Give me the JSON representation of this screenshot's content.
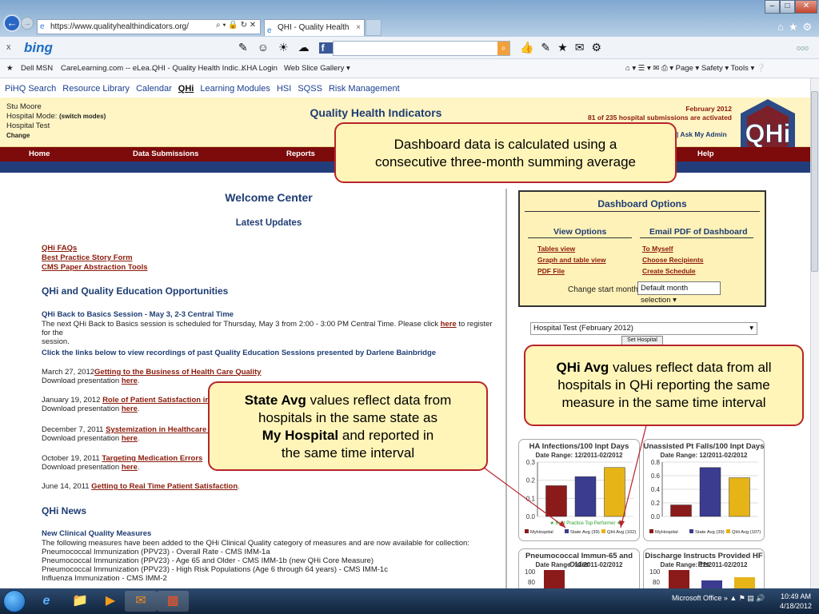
{
  "browser": {
    "address": "https://www.qualityhealthindicators.org/",
    "tab_title": "QHI - Quality Health Indica...",
    "tab_close": "×"
  },
  "bing": {
    "close": "x",
    "logo": "bing",
    "more": "ooo"
  },
  "favorites": {
    "items": [
      "Dell MSN",
      "CareLearning.com -- eLea...",
      "QHI - Quality Health Indic...",
      "KHA Login",
      "Web Slice Gallery ▾"
    ],
    "commands": "Page ▾   Safety ▾   Tools ▾"
  },
  "site_nav": {
    "items": [
      "PiHQ Search",
      "Resource Library",
      "Calendar",
      "QHi",
      "Learning Modules",
      "HSI",
      "SQSS",
      "Risk Management"
    ]
  },
  "header": {
    "user": "Stu Moore",
    "mode_label": "Hospital Mode: ",
    "switch_modes": "(switch modes)",
    "hospital": "Hospital Test",
    "change": "Change",
    "title": "Quality Health Indicators",
    "month": "February 2012",
    "submissions": "81 of 235 hospital submissions are activated",
    "links": "| Ask My Admin",
    "logo_text": "QHi"
  },
  "main_nav": {
    "home": "Home",
    "data": "Data Submissions",
    "reports": "Reports",
    "help": "Help"
  },
  "welcome": {
    "title": "Welcome Center",
    "latest": "Latest Updates",
    "links": [
      "QHi FAQs",
      "Best Practice Story Form",
      "CMS Paper Abstraction Tools"
    ],
    "edu_heading": "QHi and Quality Education Opportunities",
    "session_title": "QHi Back to Basics Session - May 3, 2-3 Central Time",
    "session_text_1": "The next QHi Back to Basics session is scheduled for Thursday, May 3 from 2:00 - 3:00 PM Central Time. Please click",
    "here": "here",
    "session_text_2": "to register for the",
    "session_text_3": "session.",
    "recordings": "Click the links below to view recordings of past Quality Education Sessions presented by Darlene Bainbridge",
    "download": "Download presentation",
    "sessions": [
      {
        "date": "March 27, 2012",
        "title": "Getting to the Business of Health Care Quality"
      },
      {
        "date": "January 19, 2012",
        "title": "Role of Patient Satisfaction in Q"
      },
      {
        "date": "December 7, 2011",
        "title": "Systemization in Healthcare Qu"
      },
      {
        "date": "October 19, 2011",
        "title": "Targeting Medication Errors"
      },
      {
        "date": "June 14, 2011",
        "title": "Getting to Real Time Patient Satisfaction"
      }
    ],
    "news_heading": "QHi News",
    "news_sub": "New Clinical Quality Measures",
    "news_lines": [
      "The following measures have been added to the QHi Clinical Quality category of measures and are now available for collection:",
      "Pneumococcal Immunization (PPV23) - Overall Rate - CMS IMM-1a",
      "Pneumococcal Immunization (PPV23) - Age 65 and Older - CMS IMM-1b (new QHi Core Measure)",
      "Pneumococcal Immunization (PPV23) - High Risk Populations (Age 6 through 64 years) - CMS IMM-1c",
      "Influenza Immunization - CMS IMM-2"
    ]
  },
  "dashboard": {
    "title": "Dashboard Options",
    "view_heading": "View Options",
    "email_heading": "Email PDF of Dashboard",
    "view_links": [
      "Tables view",
      "Graph and table view",
      "PDF File"
    ],
    "email_links": [
      "To Myself",
      "Choose Recipients",
      "Create Schedule"
    ],
    "start_month_label": "Change start month:",
    "start_month_value": "Default month selection ▾",
    "hospital_select": "Hospital Test (February 2012)",
    "set_hospital": "Set Hospital"
  },
  "callouts": {
    "dashboard_a": "Dashboard data is calculated using a",
    "dashboard_b": "consecutive three-month summing average",
    "qhi_bold": "QHi Avg",
    "qhi_a": " values reflect data from all",
    "qhi_b": "hospitals in QHi reporting the same",
    "qhi_c": "measure in the same time interval",
    "state_bold": "State Avg",
    "state_a": " values reflect data from",
    "state_b": "hospitals in the same state as",
    "state_c_bold": "My Hospital",
    "state_c": " and reported in",
    "state_d": "the same time interval"
  },
  "colors": {
    "my_hospital": "#8b1a1a",
    "state_avg": "#3b3b8f",
    "qhi_avg": "#e6b417",
    "accent_red": "#7d0b0b",
    "navy": "#1e3d73"
  },
  "chart_data": [
    {
      "type": "bar",
      "title": "HA Infections/100 Inpt Days",
      "subtitle": "Date Range: 12/2011-02/2012",
      "categories": [
        "MyHospital",
        "State Avg (39)",
        "QHi Avg (102)"
      ],
      "values": [
        0.17,
        0.22,
        0.27
      ],
      "ylim": [
        0,
        0.3
      ],
      "yticks": [
        "0.3",
        "0.2",
        "0.1",
        "0.0"
      ],
      "legend": [
        "MyHospital",
        "State Avg (39)",
        "QHi Avg (102)"
      ],
      "annotation": "Best Practice Top Performer",
      "grid": true
    },
    {
      "type": "bar",
      "title": "Unassisted Pt Falls/100 Inpt Days",
      "subtitle": "Date Range: 12/2011-02/2012",
      "categories": [
        "MyHospital",
        "State Avg (39)",
        "QHi Avg (107)"
      ],
      "values": [
        0.17,
        0.72,
        0.57
      ],
      "ylim": [
        0,
        0.8
      ],
      "yticks": [
        "0.8",
        "0.6",
        "0.4",
        "0.2",
        "0.0"
      ],
      "legend": [
        "MyHospital",
        "State Avg (39)",
        "QHi Avg (107)"
      ],
      "grid": true
    },
    {
      "type": "bar",
      "title": "Pneumococcal Immun-65 and Older",
      "subtitle": "Date Range: 12/2011-02/2012",
      "yticks": [
        "100",
        "80"
      ]
    },
    {
      "type": "bar",
      "title": "Discharge Instructs Provided HF Pts",
      "subtitle": "Date Range: 12/2011-02/2012",
      "yticks": [
        "100",
        "80"
      ]
    }
  ],
  "taskbar": {
    "tray": "Microsoft Office",
    "time": "10:49 AM",
    "date": "4/18/2012"
  }
}
